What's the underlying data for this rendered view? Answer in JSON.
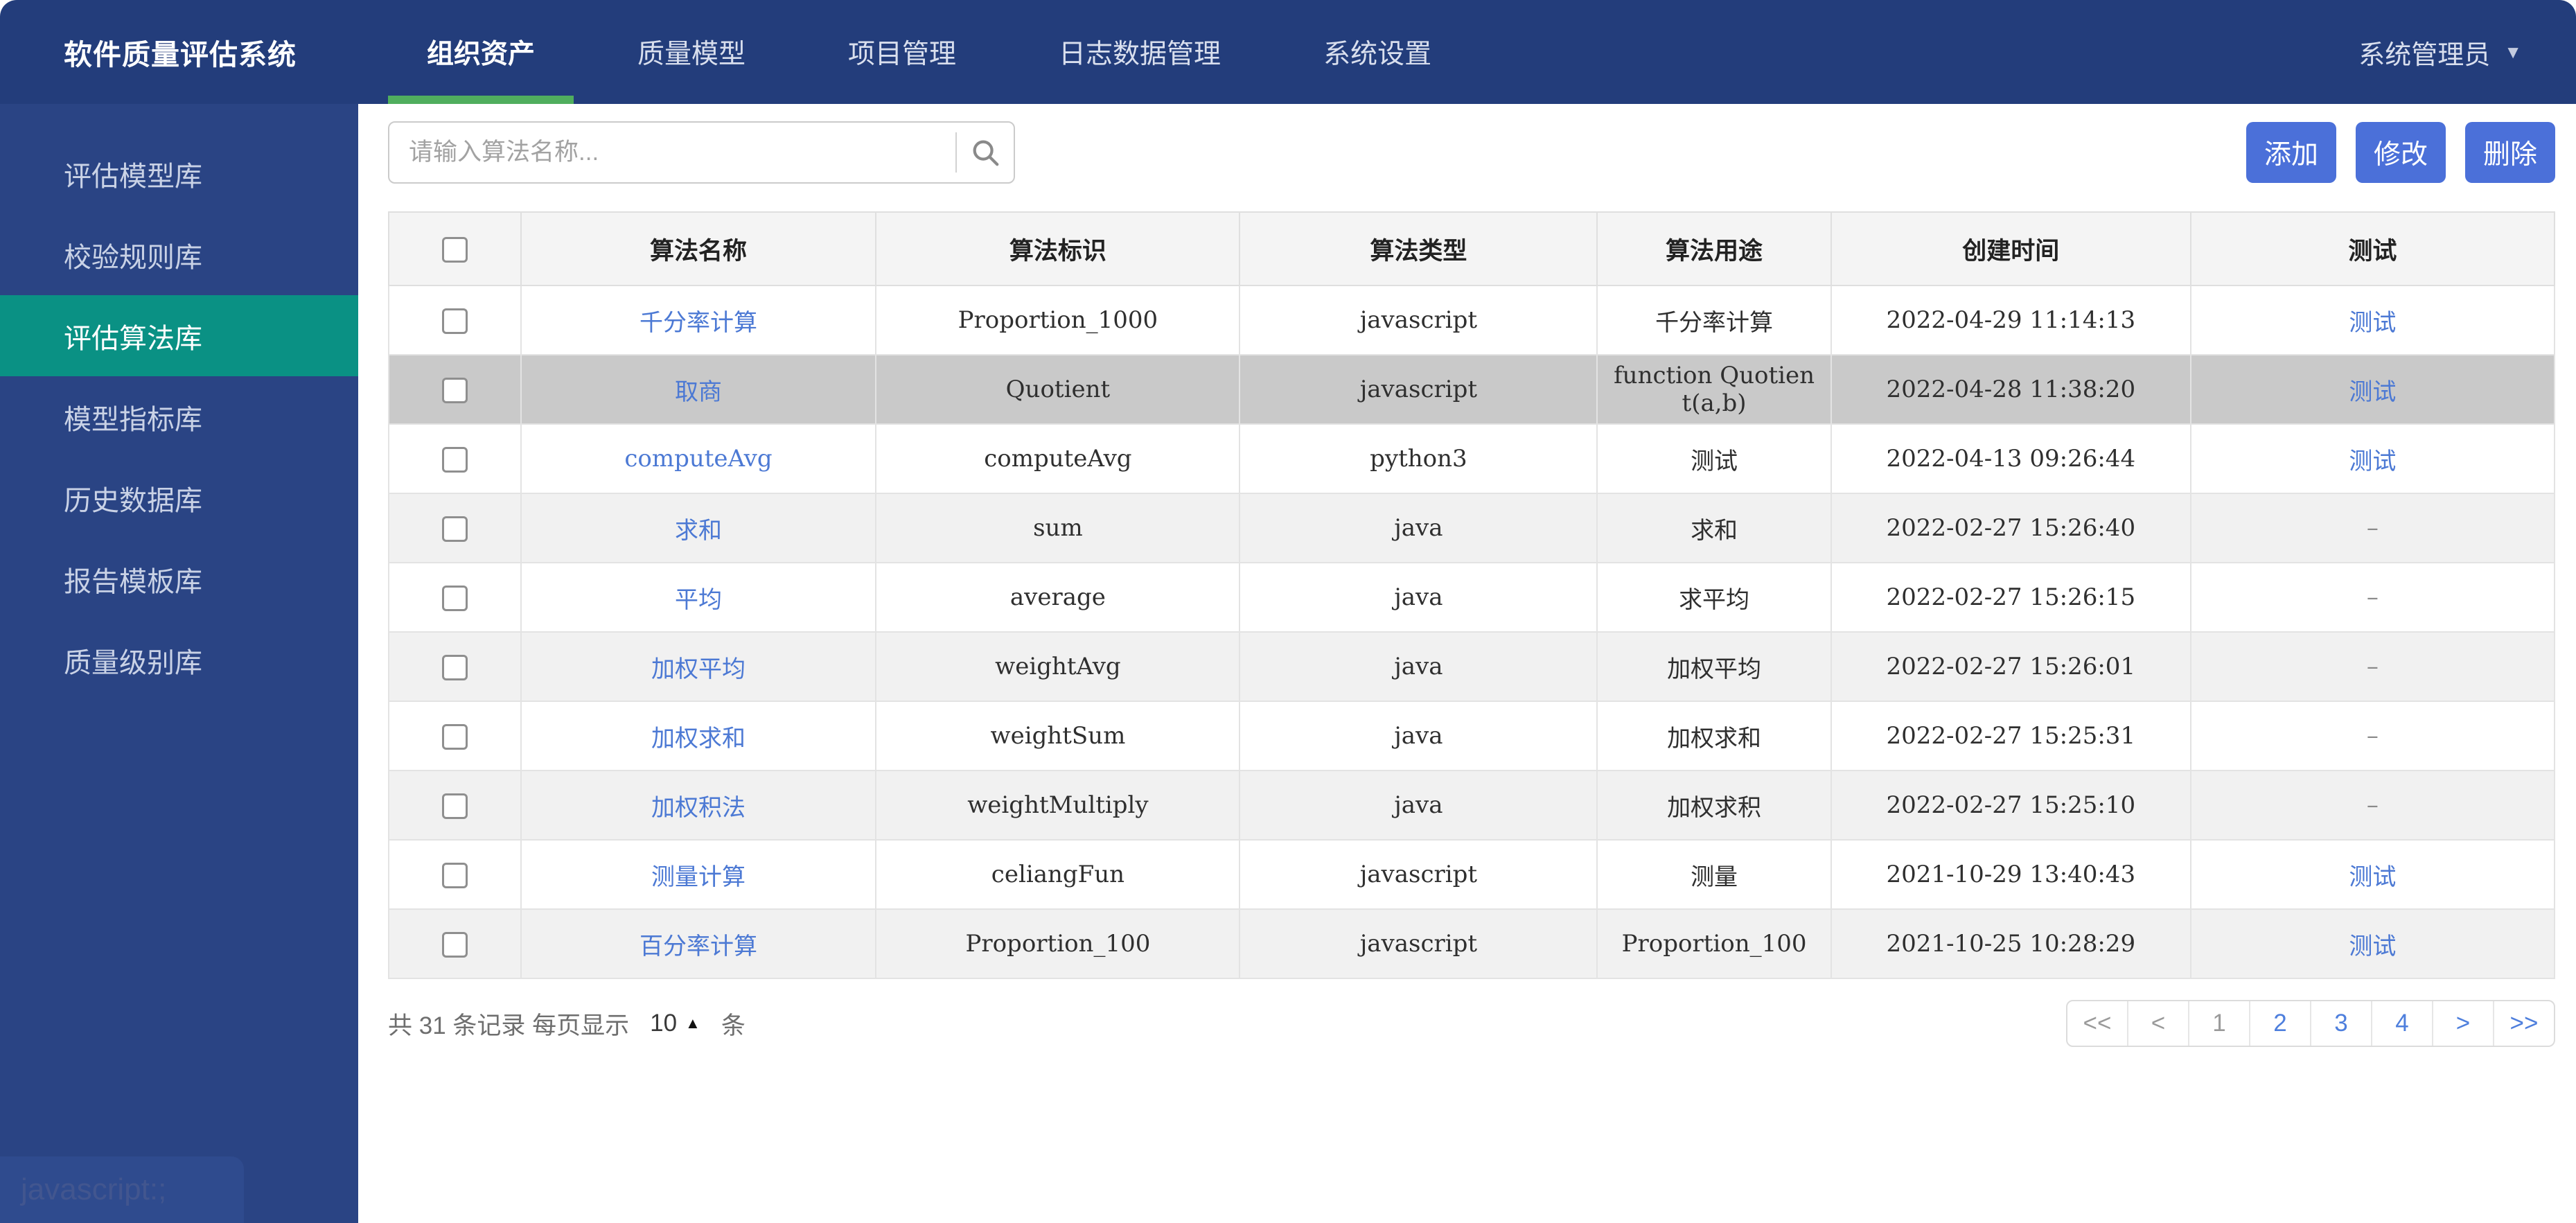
{
  "app": {
    "title": "软件质量评估系统",
    "user": "系统管理员",
    "dropdown_icon": "▼"
  },
  "nav": {
    "tabs": [
      {
        "label": "组织资产",
        "active": true
      },
      {
        "label": "质量模型",
        "active": false
      },
      {
        "label": "项目管理",
        "active": false
      },
      {
        "label": "日志数据管理",
        "active": false
      },
      {
        "label": "系统设置",
        "active": false
      }
    ]
  },
  "sidebar": {
    "items": [
      {
        "label": "评估模型库",
        "active": false
      },
      {
        "label": "校验规则库",
        "active": false
      },
      {
        "label": "评估算法库",
        "active": true
      },
      {
        "label": "模型指标库",
        "active": false
      },
      {
        "label": "历史数据库",
        "active": false
      },
      {
        "label": "报告模板库",
        "active": false
      },
      {
        "label": "质量级别库",
        "active": false
      }
    ]
  },
  "toolbar": {
    "search_placeholder": "请输入算法名称...",
    "add_label": "添加",
    "edit_label": "修改",
    "delete_label": "删除"
  },
  "table": {
    "columns": [
      "算法名称",
      "算法标识",
      "算法类型",
      "算法用途",
      "创建时间",
      "测试"
    ],
    "rows": [
      {
        "name": "千分率计算",
        "id": "Proportion_1000",
        "type": "javascript",
        "usage": "千分率计算",
        "created": "2022-04-29 11:14:13",
        "test": "测试",
        "has_test_link": true,
        "selected": false
      },
      {
        "name": "取商",
        "id": "Quotient",
        "type": "javascript",
        "usage": "function Quotient(a,b)",
        "created": "2022-04-28 11:38:20",
        "test": "测试",
        "has_test_link": true,
        "selected": true
      },
      {
        "name": "computeAvg",
        "id": "computeAvg",
        "type": "python3",
        "usage": "测试",
        "created": "2022-04-13 09:26:44",
        "test": "测试",
        "has_test_link": true,
        "selected": false
      },
      {
        "name": "求和",
        "id": "sum",
        "type": "java",
        "usage": "求和",
        "created": "2022-02-27 15:26:40",
        "test": "–",
        "has_test_link": false,
        "selected": false
      },
      {
        "name": "平均",
        "id": "average",
        "type": "java",
        "usage": "求平均",
        "created": "2022-02-27 15:26:15",
        "test": "–",
        "has_test_link": false,
        "selected": false
      },
      {
        "name": "加权平均",
        "id": "weightAvg",
        "type": "java",
        "usage": "加权平均",
        "created": "2022-02-27 15:26:01",
        "test": "–",
        "has_test_link": false,
        "selected": false
      },
      {
        "name": "加权求和",
        "id": "weightSum",
        "type": "java",
        "usage": "加权求和",
        "created": "2022-02-27 15:25:31",
        "test": "–",
        "has_test_link": false,
        "selected": false
      },
      {
        "name": "加权积法",
        "id": "weightMultiply",
        "type": "java",
        "usage": "加权求积",
        "created": "2022-02-27 15:25:10",
        "test": "–",
        "has_test_link": false,
        "selected": false
      },
      {
        "name": "测量计算",
        "id": "celiangFun",
        "type": "javascript",
        "usage": "测量",
        "created": "2021-10-29 13:40:43",
        "test": "测试",
        "has_test_link": true,
        "selected": false
      },
      {
        "name": "百分率计算",
        "id": "Proportion_100",
        "type": "javascript",
        "usage": "Proportion_100",
        "created": "2021-10-25 10:28:29",
        "test": "测试",
        "has_test_link": true,
        "selected": false
      }
    ]
  },
  "footer": {
    "records_text": "共 31 条记录 每页显示",
    "page_size": "10",
    "page_size_icon": "▲",
    "unit_text": "条",
    "pagination": [
      {
        "label": "<<",
        "muted": true
      },
      {
        "label": "<",
        "muted": true
      },
      {
        "label": "1",
        "muted": true
      },
      {
        "label": "2",
        "muted": false
      },
      {
        "label": "3",
        "muted": false
      },
      {
        "label": "4",
        "muted": false
      },
      {
        "label": ">",
        "muted": false
      },
      {
        "label": ">>",
        "muted": false
      }
    ]
  },
  "statusbar": {
    "link_preview": "javascript:;"
  },
  "colors": {
    "header_bg": "#233d7b",
    "sidebar_bg": "#2a4484",
    "active_item_teal": "#0a9184",
    "tab_underline_green": "#50ae5e",
    "button_blue": "#4b70d9",
    "link_blue": "#4c79d4",
    "pagination_blue": "#4e7fdd",
    "selected_row_gray": "#c9c9c9",
    "stripe_gray": "#f1f1f1",
    "header_row_gray": "#f4f4f4"
  }
}
